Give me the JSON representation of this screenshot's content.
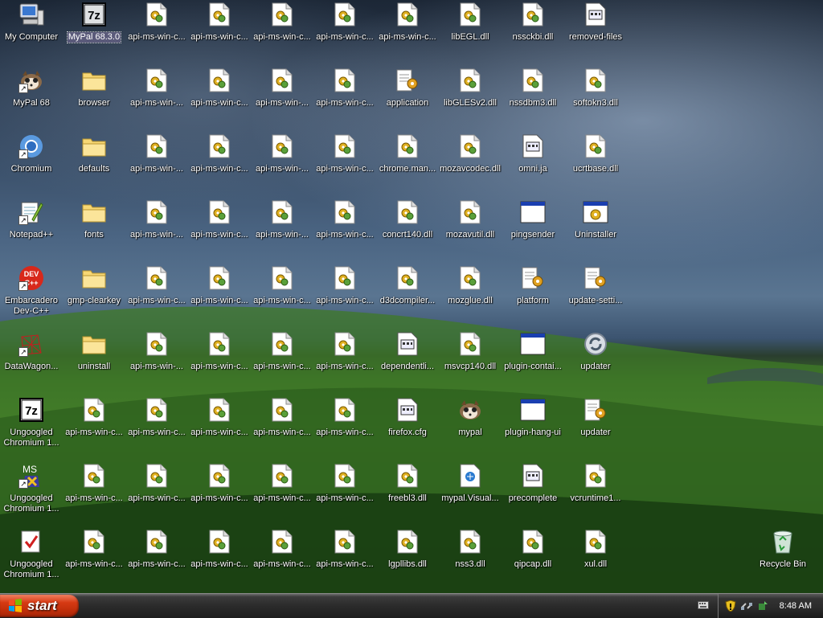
{
  "desktop": {
    "icons": [
      {
        "label": "My Computer",
        "type": "computer"
      },
      {
        "label": "MyPal 68",
        "type": "mypal",
        "shortcut": true
      },
      {
        "label": "Chromium",
        "type": "chromium",
        "shortcut": true
      },
      {
        "label": "Notepad++",
        "type": "notepad",
        "shortcut": true
      },
      {
        "label": "Embarcadero Dev-C++",
        "type": "devcpp",
        "shortcut": true,
        "wrap": true
      },
      {
        "label": "DataWagon...",
        "type": "datawagon",
        "shortcut": true
      },
      {
        "label": "Ungoogled Chromium 1...",
        "type": "sevenzip",
        "wrap": true
      },
      {
        "label": "Ungoogled Chromium 1...",
        "type": "msvs",
        "shortcut": true,
        "wrap": true
      },
      {
        "label": "Ungoogled Chromium 1...",
        "type": "check",
        "wrap": true
      },
      {
        "label": "MyPal 68.3.0",
        "type": "sevenzip",
        "selected": true
      },
      {
        "label": "browser",
        "type": "folder"
      },
      {
        "label": "defaults",
        "type": "folder"
      },
      {
        "label": "fonts",
        "type": "folder"
      },
      {
        "label": "gmp-clearkey",
        "type": "folder"
      },
      {
        "label": "uninstall",
        "type": "folder"
      },
      {
        "label": "api-ms-win-c...",
        "type": "dll"
      },
      {
        "label": "api-ms-win-c...",
        "type": "dll"
      },
      {
        "label": "api-ms-win-c...",
        "type": "dll"
      },
      {
        "label": "api-ms-win-c...",
        "type": "dll"
      },
      {
        "label": "api-ms-win-...",
        "type": "dll"
      },
      {
        "label": "api-ms-win-...",
        "type": "dll"
      },
      {
        "label": "api-ms-win-...",
        "type": "dll"
      },
      {
        "label": "api-ms-win-c...",
        "type": "dll"
      },
      {
        "label": "api-ms-win-...",
        "type": "dll"
      },
      {
        "label": "api-ms-win-c...",
        "type": "dll"
      },
      {
        "label": "api-ms-win-c...",
        "type": "dll"
      },
      {
        "label": "api-ms-win-c...",
        "type": "dll"
      },
      {
        "label": "api-ms-win-c...",
        "type": "dll"
      },
      {
        "label": "api-ms-win-c...",
        "type": "dll"
      },
      {
        "label": "api-ms-win-c...",
        "type": "dll"
      },
      {
        "label": "api-ms-win-c...",
        "type": "dll"
      },
      {
        "label": "api-ms-win-c...",
        "type": "dll"
      },
      {
        "label": "api-ms-win-c...",
        "type": "dll"
      },
      {
        "label": "api-ms-win-c...",
        "type": "dll"
      },
      {
        "label": "api-ms-win-c...",
        "type": "dll"
      },
      {
        "label": "api-ms-win-c...",
        "type": "dll"
      },
      {
        "label": "api-ms-win-c...",
        "type": "dll"
      },
      {
        "label": "api-ms-win-...",
        "type": "dll"
      },
      {
        "label": "api-ms-win-...",
        "type": "dll"
      },
      {
        "label": "api-ms-win-...",
        "type": "dll"
      },
      {
        "label": "api-ms-win-c...",
        "type": "dll"
      },
      {
        "label": "api-ms-win-c...",
        "type": "dll"
      },
      {
        "label": "api-ms-win-c...",
        "type": "dll"
      },
      {
        "label": "api-ms-win-c...",
        "type": "dll"
      },
      {
        "label": "api-ms-win-c...",
        "type": "dll"
      },
      {
        "label": "api-ms-win-c...",
        "type": "dll"
      },
      {
        "label": "api-ms-win-c...",
        "type": "dll"
      },
      {
        "label": "api-ms-win-c...",
        "type": "dll"
      },
      {
        "label": "api-ms-win-c...",
        "type": "dll"
      },
      {
        "label": "api-ms-win-c...",
        "type": "dll"
      },
      {
        "label": "api-ms-win-c...",
        "type": "dll"
      },
      {
        "label": "api-ms-win-c...",
        "type": "dll"
      },
      {
        "label": "api-ms-win-c...",
        "type": "dll"
      },
      {
        "label": "api-ms-win-c...",
        "type": "dll"
      },
      {
        "label": "api-ms-win-c...",
        "type": "dll"
      },
      {
        "label": "application",
        "type": "settings"
      },
      {
        "label": "chrome.man...",
        "type": "dll"
      },
      {
        "label": "concrt140.dll",
        "type": "dll"
      },
      {
        "label": "d3dcompiler...",
        "type": "dll"
      },
      {
        "label": "dependentli...",
        "type": "textfile"
      },
      {
        "label": "firefox.cfg",
        "type": "textfile"
      },
      {
        "label": "freebl3.dll",
        "type": "dll"
      },
      {
        "label": "lgpllibs.dll",
        "type": "dll"
      },
      {
        "label": "libEGL.dll",
        "type": "dll"
      },
      {
        "label": "libGLESv2.dll",
        "type": "dll"
      },
      {
        "label": "mozavcodec.dll",
        "type": "dll"
      },
      {
        "label": "mozavutil.dll",
        "type": "dll"
      },
      {
        "label": "mozglue.dll",
        "type": "dll"
      },
      {
        "label": "msvcp140.dll",
        "type": "dll"
      },
      {
        "label": "mypal",
        "type": "mypal"
      },
      {
        "label": "mypal.Visual...",
        "type": "manifest"
      },
      {
        "label": "nss3.dll",
        "type": "dll"
      },
      {
        "label": "nssckbi.dll",
        "type": "dll"
      },
      {
        "label": "nssdbm3.dll",
        "type": "dll"
      },
      {
        "label": "omni.ja",
        "type": "textfile"
      },
      {
        "label": "pingsender",
        "type": "window"
      },
      {
        "label": "platform",
        "type": "settings"
      },
      {
        "label": "plugin-contai...",
        "type": "window"
      },
      {
        "label": "plugin-hang-ui",
        "type": "window"
      },
      {
        "label": "precomplete",
        "type": "textfile"
      },
      {
        "label": "qipcap.dll",
        "type": "dll"
      },
      {
        "label": "removed-files",
        "type": "textfile"
      },
      {
        "label": "softokn3.dll",
        "type": "dll"
      },
      {
        "label": "ucrtbase.dll",
        "type": "dll"
      },
      {
        "label": "Uninstaller",
        "type": "uninstaller"
      },
      {
        "label": "update-setti...",
        "type": "settings"
      },
      {
        "label": "updater",
        "type": "updater"
      },
      {
        "label": "updater",
        "type": "settings"
      },
      {
        "label": "vcruntime1...",
        "type": "dll"
      },
      {
        "label": "xul.dll",
        "type": "dll"
      },
      {
        "label": "Recycle Bin",
        "type": "recycle"
      }
    ]
  },
  "taskbar": {
    "start_label": "start",
    "clock": "8:48 AM"
  }
}
